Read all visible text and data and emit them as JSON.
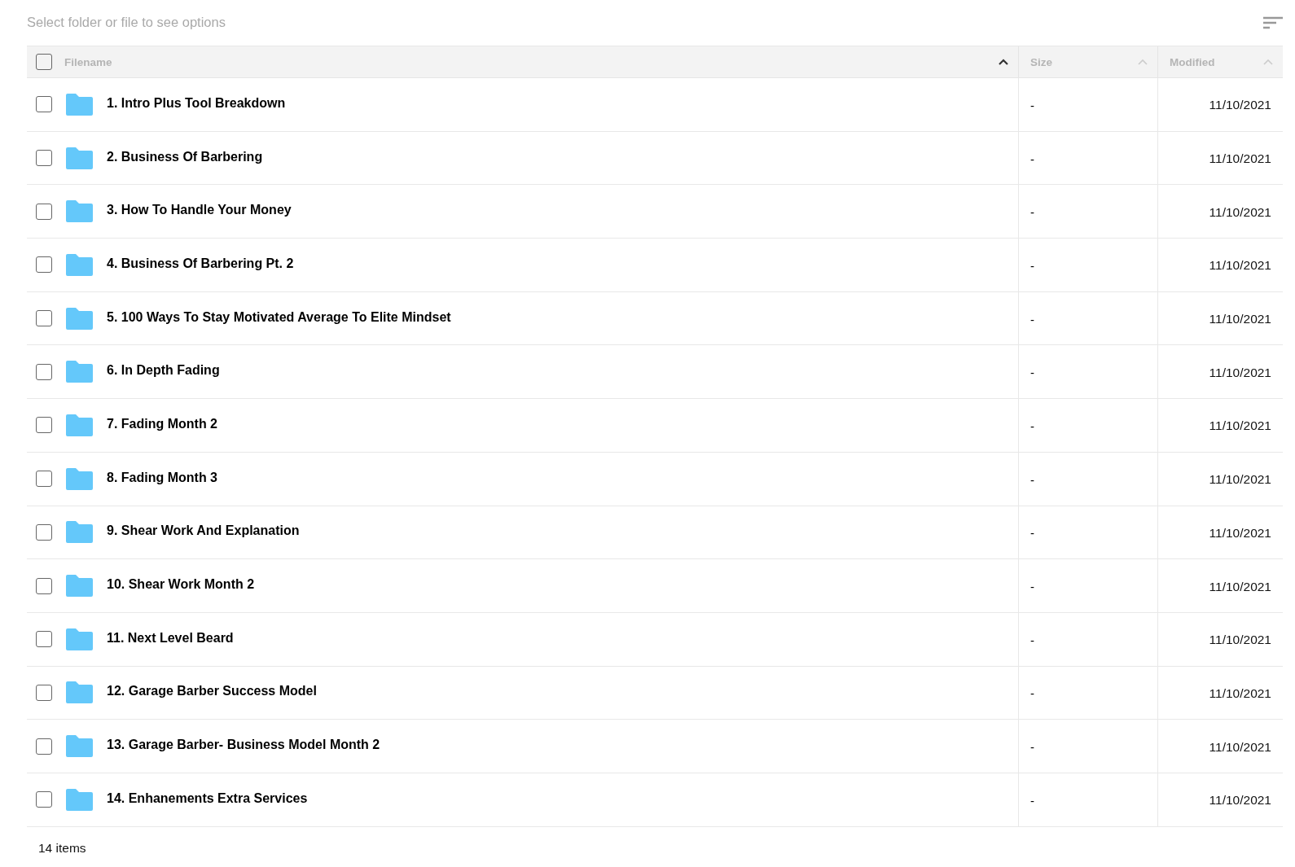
{
  "toolbar": {
    "hint": "Select folder or file to see options"
  },
  "table": {
    "select_all": {
      "checked": false
    },
    "columns": [
      {
        "label": "Filename",
        "sorted": true
      },
      {
        "label": "Size",
        "sorted": false
      },
      {
        "label": "Modified",
        "sorted": false
      }
    ],
    "rows": [
      {
        "checked": false,
        "kind": "folder",
        "name": "1. Intro Plus Tool Breakdown",
        "size": "-",
        "modified": "11/10/2021"
      },
      {
        "checked": false,
        "kind": "folder",
        "name": "2. Business Of Barbering",
        "size": "-",
        "modified": "11/10/2021"
      },
      {
        "checked": false,
        "kind": "folder",
        "name": "3. How To Handle Your Money",
        "size": "-",
        "modified": "11/10/2021"
      },
      {
        "checked": false,
        "kind": "folder",
        "name": "4. Business Of Barbering Pt. 2",
        "size": "-",
        "modified": "11/10/2021"
      },
      {
        "checked": false,
        "kind": "folder",
        "name": "5. 100 Ways To Stay Motivated Average To Elite Mindset",
        "size": "-",
        "modified": "11/10/2021"
      },
      {
        "checked": false,
        "kind": "folder",
        "name": "6. In Depth Fading",
        "size": "-",
        "modified": "11/10/2021"
      },
      {
        "checked": false,
        "kind": "folder",
        "name": "7. Fading Month 2",
        "size": "-",
        "modified": "11/10/2021"
      },
      {
        "checked": false,
        "kind": "folder",
        "name": "8. Fading Month 3",
        "size": "-",
        "modified": "11/10/2021"
      },
      {
        "checked": false,
        "kind": "folder",
        "name": "9. Shear Work And Explanation",
        "size": "-",
        "modified": "11/10/2021"
      },
      {
        "checked": false,
        "kind": "folder",
        "name": "10. Shear Work Month 2",
        "size": "-",
        "modified": "11/10/2021"
      },
      {
        "checked": false,
        "kind": "folder",
        "name": "11. Next Level Beard",
        "size": "-",
        "modified": "11/10/2021"
      },
      {
        "checked": false,
        "kind": "folder",
        "name": "12. Garage Barber Success Model",
        "size": "-",
        "modified": "11/10/2021"
      },
      {
        "checked": false,
        "kind": "folder",
        "name": "13. Garage Barber- Business Model Month 2",
        "size": "-",
        "modified": "11/10/2021"
      },
      {
        "checked": false,
        "kind": "folder",
        "name": "14. Enhanements Extra Services",
        "size": "-",
        "modified": "11/10/2021"
      }
    ]
  },
  "footer": {
    "count": "14 items"
  }
}
